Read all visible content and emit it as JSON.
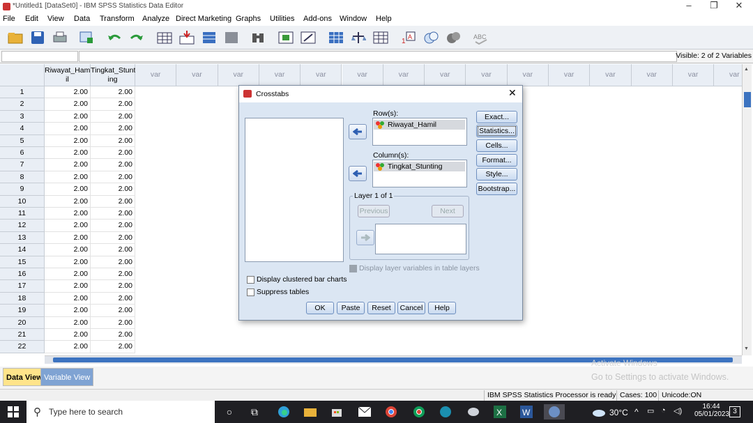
{
  "window": {
    "title": "*Untitled1 [DataSet0] - IBM SPSS Statistics Data Editor"
  },
  "menu": [
    "File",
    "Edit",
    "View",
    "Data",
    "Transform",
    "Analyze",
    "Direct Marketing",
    "Graphs",
    "Utilities",
    "Add-ons",
    "Window",
    "Help"
  ],
  "refbar": {
    "visible": "Visible: 2 of 2 Variables"
  },
  "grid": {
    "columns": [
      {
        "l1": "Riwayat_Ham",
        "l2": "il"
      },
      {
        "l1": "Tingkat_Stunt",
        "l2": "ing"
      }
    ],
    "var_label": "var",
    "rows": [
      "1",
      "2",
      "3",
      "4",
      "5",
      "6",
      "7",
      "8",
      "9",
      "10",
      "11",
      "12",
      "13",
      "14",
      "15",
      "16",
      "17",
      "18",
      "19",
      "20",
      "21",
      "22"
    ],
    "value": "2.00"
  },
  "tabs": {
    "data_view": "Data View",
    "variable_view": "Variable View"
  },
  "status": {
    "processor": "IBM SPSS Statistics Processor is ready",
    "cases": "Cases: 100",
    "unicode": "Unicode:ON",
    "activate1": "Go to Settings to activate Windows.",
    "activate0": "Activate Windows"
  },
  "dialog": {
    "title": "Crosstabs",
    "rows_label": "Row(s):",
    "rows_value": "Riwayat_Hamil",
    "columns_label": "Column(s):",
    "columns_value": "Tingkat_Stunting",
    "layer_label": "Layer 1 of 1",
    "previous": "Previous",
    "next": "Next",
    "display_layer": "Display layer variables in table layers",
    "clustered": "Display clustered bar charts",
    "suppress": "Suppress tables",
    "side_buttons": [
      "Exact...",
      "Statistics...",
      "Cells...",
      "Format...",
      "Style...",
      "Bootstrap..."
    ],
    "bottom_buttons": [
      "OK",
      "Paste",
      "Reset",
      "Cancel",
      "Help"
    ]
  },
  "taskbar": {
    "search": "Type here to search",
    "weather": "30°C",
    "time": "16:44",
    "date": "05/01/2023",
    "notif": "3"
  }
}
